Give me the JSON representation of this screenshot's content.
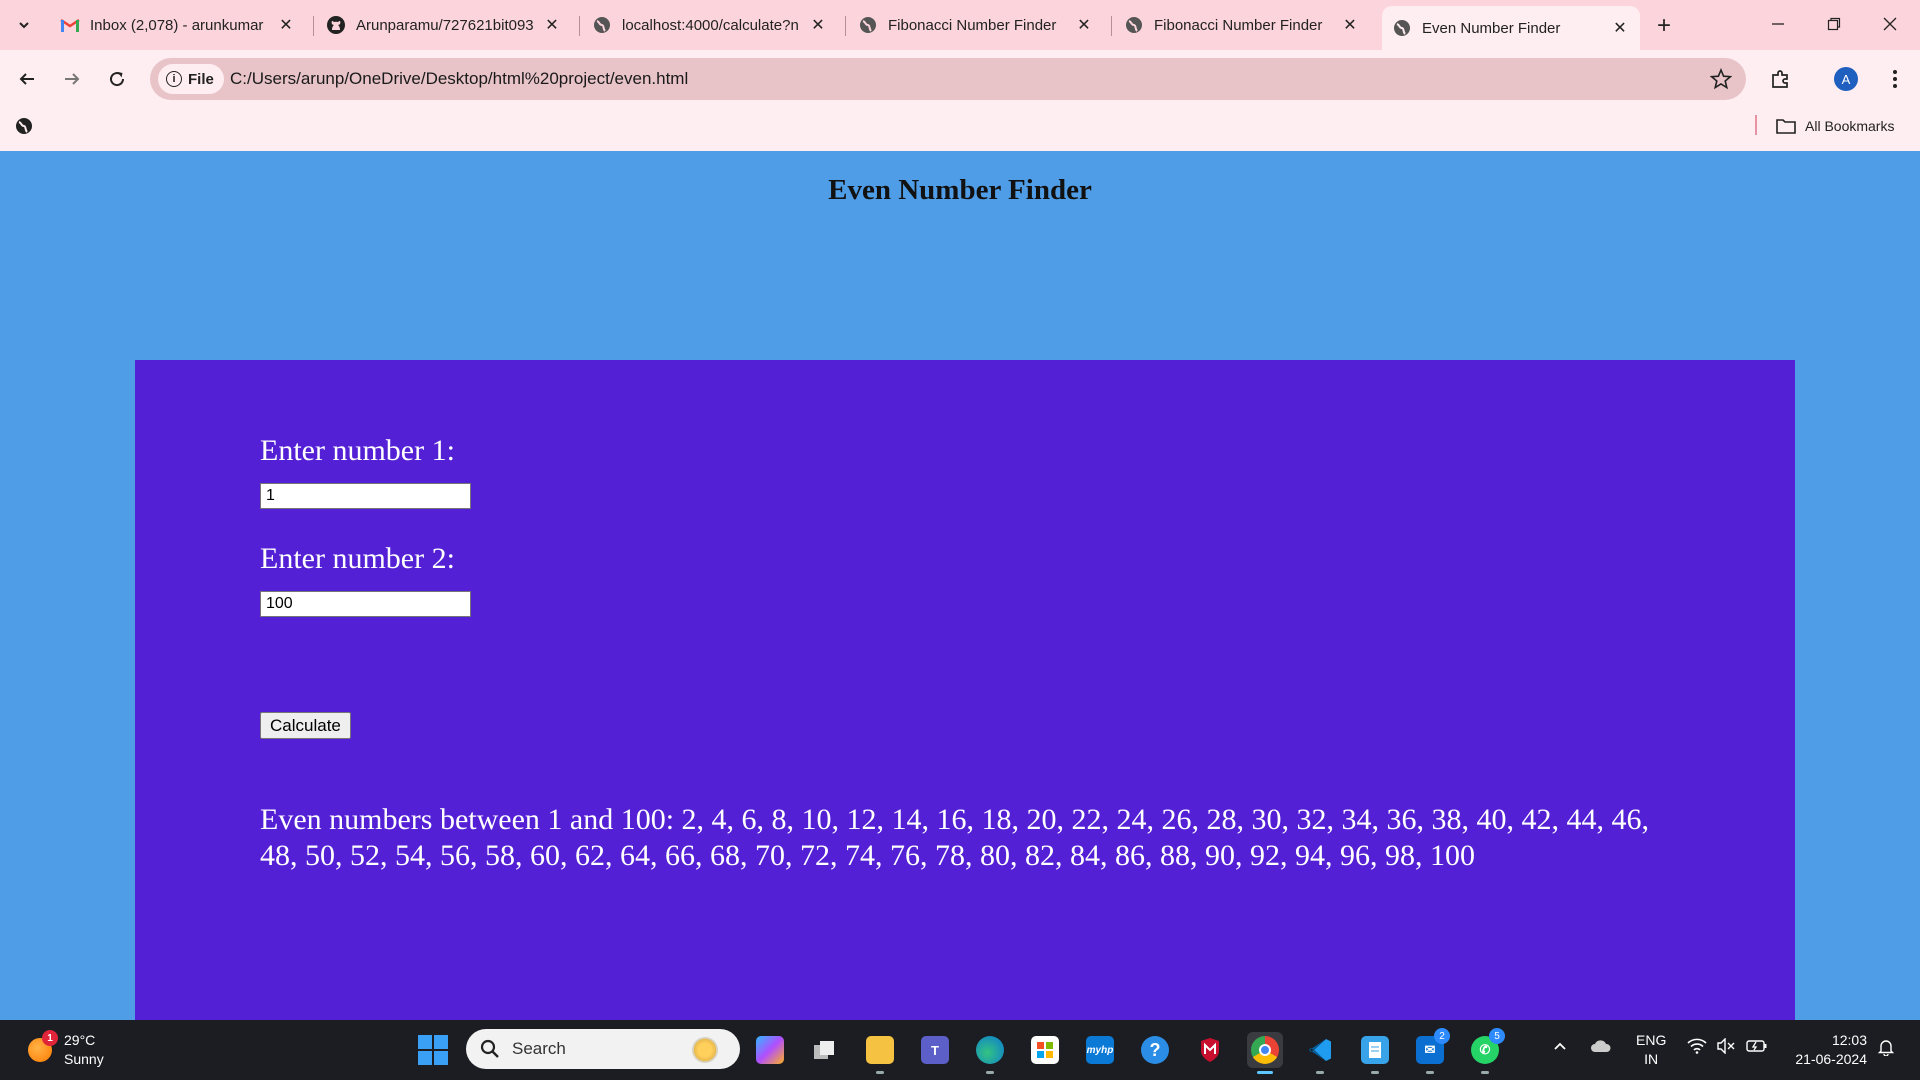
{
  "browser": {
    "tabs": [
      {
        "title": "Inbox (2,078) - arunkumar",
        "favicon": "gmail-icon"
      },
      {
        "title": "Arunparamu/727621bit093",
        "favicon": "github-icon"
      },
      {
        "title": "localhost:4000/calculate?n",
        "favicon": "globe-icon"
      },
      {
        "title": "Fibonacci Number Finder",
        "favicon": "globe-icon"
      },
      {
        "title": "Fibonacci Number Finder",
        "favicon": "globe-icon"
      },
      {
        "title": "Even Number Finder",
        "favicon": "globe-icon",
        "active": true
      }
    ],
    "address_chip": "File",
    "url": "C:/Users/arunp/OneDrive/Desktop/html%20project/even.html",
    "profile_initial": "A",
    "all_bookmarks": "All Bookmarks"
  },
  "page": {
    "title": "Even Number Finder",
    "label1": "Enter number 1:",
    "value1": "1",
    "label2": "Enter number 2:",
    "value2": "100",
    "button": "Calculate",
    "result": "Even numbers between 1 and 100: 2, 4, 6, 8, 10, 12, 14, 16, 18, 20, 22, 24, 26, 28, 30, 32, 34, 36, 38, 40, 42, 44, 46, 48, 50, 52, 54, 56, 58, 60, 62, 64, 66, 68, 70, 72, 74, 76, 78, 80, 82, 84, 86, 88, 90, 92, 94, 96, 98, 100"
  },
  "colors": {
    "page_bg": "#4f9de6",
    "panel_bg": "#5420d6",
    "chrome_tabstrip": "#fcd5dc",
    "chrome_toolbar": "#ffeef1"
  },
  "taskbar": {
    "weather": {
      "temp": "29°C",
      "condition": "Sunny",
      "badge": "1"
    },
    "search": "Search",
    "apps": [
      {
        "name": "copilot-icon"
      },
      {
        "name": "task-view-icon"
      },
      {
        "name": "file-explorer-icon"
      },
      {
        "name": "teams-icon"
      },
      {
        "name": "edge-icon"
      },
      {
        "name": "microsoft-store-icon"
      },
      {
        "name": "myhp-icon",
        "label": "myhp"
      },
      {
        "name": "get-help-icon"
      },
      {
        "name": "mcafee-icon"
      },
      {
        "name": "chrome-icon"
      },
      {
        "name": "vscode-icon"
      },
      {
        "name": "notepad-icon"
      },
      {
        "name": "mail-icon",
        "badge": "2"
      },
      {
        "name": "whatsapp-icon",
        "badge": "5"
      }
    ],
    "lang": {
      "line1": "ENG",
      "line2": "IN"
    },
    "time": "12:03",
    "date": "21-06-2024"
  }
}
